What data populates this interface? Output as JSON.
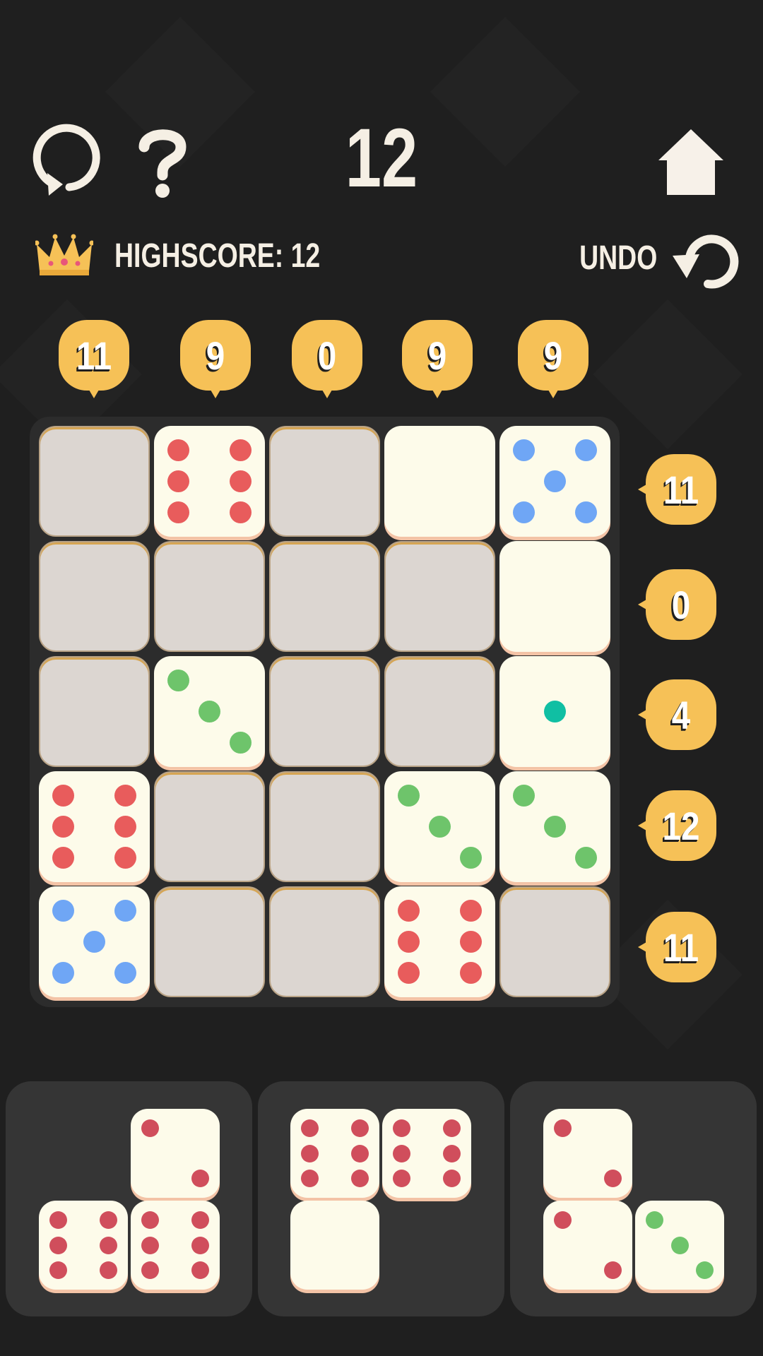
{
  "score": "12",
  "highscore": {
    "label": "HIGHSCORE: 12"
  },
  "undo": {
    "label": "UNDO"
  },
  "icons": {
    "restart": "restart-icon",
    "help": "question-mark-icon",
    "home": "home-icon",
    "crown": "crown-icon",
    "undo": "undo-icon"
  },
  "column_hints": [
    "11",
    "9",
    "0",
    "9",
    "9"
  ],
  "row_hints": [
    "11",
    "0",
    "4",
    "12",
    "11"
  ],
  "colors": {
    "background": "#1f1f1f",
    "hint": "#f6c157",
    "empty_cell": "#dcd6d1",
    "die_face": "#fdfbea",
    "pip_red": "#e85c5c",
    "pip_blue": "#6fa6f5",
    "pip_green": "#6ec46b",
    "pip_teal": "#10bfa3",
    "tray_pip_red": "#d04e5c"
  },
  "board": [
    [
      null,
      {
        "value": 6,
        "color": "red"
      },
      null,
      {
        "value": 0,
        "color": "none"
      },
      {
        "value": 5,
        "color": "blue"
      }
    ],
    [
      null,
      null,
      null,
      null,
      {
        "value": 0,
        "color": "none"
      }
    ],
    [
      null,
      {
        "value": 3,
        "color": "green"
      },
      null,
      null,
      {
        "value": 1,
        "color": "teal"
      }
    ],
    [
      {
        "value": 6,
        "color": "red"
      },
      null,
      null,
      {
        "value": 3,
        "color": "green"
      },
      {
        "value": 3,
        "color": "green"
      }
    ],
    [
      {
        "value": 5,
        "color": "blue"
      },
      null,
      null,
      {
        "value": 6,
        "color": "red"
      },
      null
    ]
  ],
  "trays": [
    {
      "pieces": [
        {
          "row": 0,
          "col": 1,
          "value": 2,
          "color": "red"
        },
        {
          "row": 1,
          "col": 0,
          "value": 6,
          "color": "red"
        },
        {
          "row": 1,
          "col": 1,
          "value": 6,
          "color": "red"
        }
      ]
    },
    {
      "pieces": [
        {
          "row": 0,
          "col": 0,
          "value": 6,
          "color": "red"
        },
        {
          "row": 0,
          "col": 1,
          "value": 6,
          "color": "red"
        },
        {
          "row": 1,
          "col": 0,
          "value": 0,
          "color": "none"
        }
      ]
    },
    {
      "pieces": [
        {
          "row": 0,
          "col": 0,
          "value": 2,
          "color": "red"
        },
        {
          "row": 1,
          "col": 0,
          "value": 2,
          "color": "red"
        },
        {
          "row": 1,
          "col": 1,
          "value": 3,
          "color": "green"
        }
      ]
    }
  ]
}
